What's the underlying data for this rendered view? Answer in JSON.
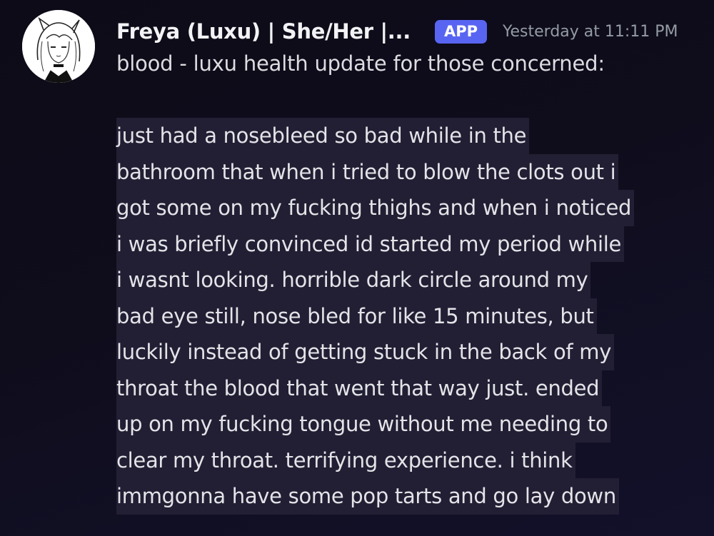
{
  "message": {
    "author": "Freya (Luxu) | She/Her |...",
    "badge": "APP",
    "timestamp": "Yesterday at 11:11 PM",
    "first_line": "blood - luxu health update for those concerned:",
    "body_lines": [
      "just had a nosebleed so bad while in the",
      "bathroom that when i tried to blow the clots out i",
      "got some on my fucking thighs and when i noticed",
      "i was briefly convinced id started my period while",
      "i wasnt looking. horrible dark circle around my",
      "bad eye still, nose bled for like 15 minutes, but",
      "luckily instead of getting stuck in the back of my",
      "throat the blood that went that way just. ended",
      "up on my fucking tongue without me needing to",
      "clear my throat. terrifying experience. i think",
      "immgonna have some pop tarts and go lay down"
    ]
  },
  "colors": {
    "background": "#0f0d1c",
    "badge": "#5865f2",
    "highlight": "#221f34",
    "timestamp": "#949ba4"
  },
  "icons": {
    "avatar": "anime-girl-sketch-avatar"
  }
}
